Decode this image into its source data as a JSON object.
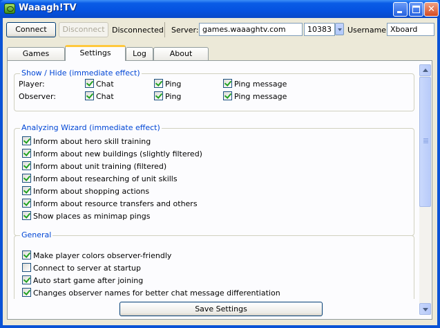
{
  "window": {
    "title": "Waaagh!TV",
    "controls": {
      "minimize": "minimize-icon",
      "maximize": "maximize-icon",
      "close": "close-icon"
    }
  },
  "toolbar": {
    "connect_label": "Connect",
    "disconnect_label": "Disconnect",
    "status": "Disconnected",
    "server_label": "Server:",
    "server_value": "games.waaaghtv.com",
    "port_value": "10383",
    "username_label": "Username:",
    "username_value": "Xboard"
  },
  "tabs": [
    {
      "label": "Games",
      "active": false
    },
    {
      "label": "Settings",
      "active": true
    },
    {
      "label": "Log",
      "active": false
    },
    {
      "label": "About",
      "active": false
    }
  ],
  "show_hide": {
    "title": "Show / Hide (immediate effect)",
    "rows": [
      {
        "label": "Player:",
        "options": [
          {
            "label": "Chat",
            "checked": true
          },
          {
            "label": "Ping",
            "checked": true
          },
          {
            "label": "Ping message",
            "checked": true
          }
        ]
      },
      {
        "label": "Observer:",
        "options": [
          {
            "label": "Chat",
            "checked": true
          },
          {
            "label": "Ping",
            "checked": true
          },
          {
            "label": "Ping message",
            "checked": true
          }
        ]
      }
    ]
  },
  "wizard": {
    "title": "Analyzing Wizard (immediate effect)",
    "items": [
      {
        "label": "Inform about hero skill training",
        "checked": true
      },
      {
        "label": "Inform about new buildings (slightly filtered)",
        "checked": true
      },
      {
        "label": "Inform about unit training (filtered)",
        "checked": true
      },
      {
        "label": "Inform about researching of unit skills",
        "checked": true
      },
      {
        "label": "Inform about shopping actions",
        "checked": true
      },
      {
        "label": "Inform about resource transfers and others",
        "checked": true
      },
      {
        "label": "Show places as minimap pings",
        "checked": true
      }
    ]
  },
  "general": {
    "title": "General",
    "items": [
      {
        "label": "Make player colors observer-friendly",
        "checked": true
      },
      {
        "label": "Connect to server at startup",
        "checked": false
      },
      {
        "label": "Auto start game after joining",
        "checked": true
      },
      {
        "label": "Changes observer names for better chat message differentiation",
        "checked": true
      }
    ]
  },
  "save_label": "Save Settings",
  "colors": {
    "titlebar": "#0a5ce6",
    "group_title": "#0046d5",
    "tab_highlight": "#ffc83c",
    "check": "#21a121"
  }
}
